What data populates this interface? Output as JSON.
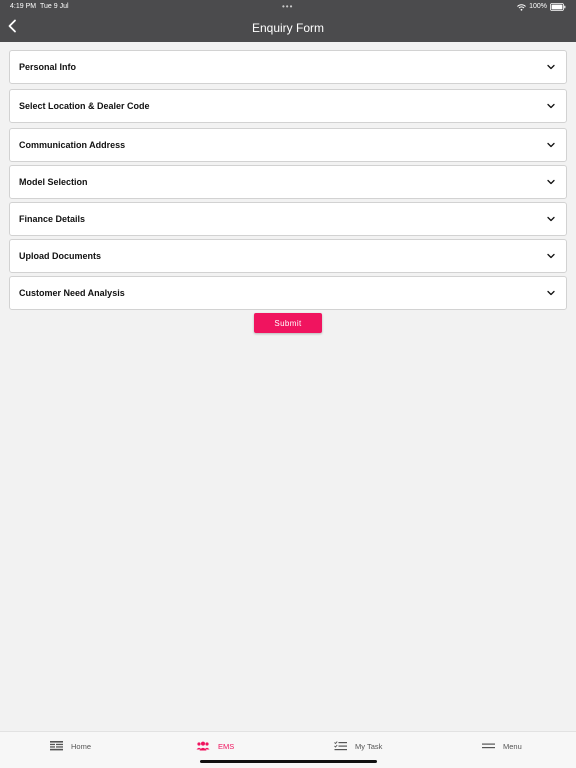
{
  "status_bar": {
    "time": "4:19 PM",
    "date": "Tue 9 Jul",
    "dots": "•••",
    "battery": "100%"
  },
  "header": {
    "title": "Enquiry Form",
    "back_icon": "chevron-left-icon"
  },
  "sections": [
    {
      "label": "Personal Info"
    },
    {
      "label": "Select Location & Dealer Code"
    },
    {
      "label": "Communication Address"
    },
    {
      "label": "Model Selection"
    },
    {
      "label": "Finance Details"
    },
    {
      "label": "Upload Documents"
    },
    {
      "label": "Customer Need Analysis"
    }
  ],
  "submit_label": "Submit",
  "tabs": [
    {
      "label": "Home",
      "icon": "home-list-icon",
      "active": false
    },
    {
      "label": "EMS",
      "icon": "people-icon",
      "active": true
    },
    {
      "label": "My Task",
      "icon": "task-list-icon",
      "active": false
    },
    {
      "label": "Menu",
      "icon": "menu-icon",
      "active": false
    }
  ],
  "colors": {
    "header_bg": "#4b4b4d",
    "accent": "#f0145f",
    "page_bg": "#f2f2f2"
  }
}
